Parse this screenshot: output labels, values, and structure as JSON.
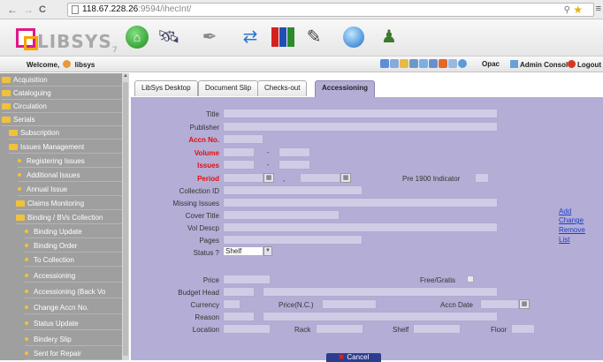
{
  "browser": {
    "url_host": "118.67.228.26",
    "url_rest": ":9594/ihecInt/",
    "back": "←",
    "forward": "→",
    "reload": "C"
  },
  "app": {
    "logo_text": "LIBSYS",
    "logo_version": "7"
  },
  "welcome": {
    "label": "Welcome,",
    "user": "libsys",
    "opac": "Opac",
    "admin_console": "Admin Console",
    "logout": "Logout"
  },
  "sidebar": {
    "items": [
      {
        "label": "Acquisition",
        "kind": "folder"
      },
      {
        "label": "Cataloguing",
        "kind": "folder"
      },
      {
        "label": "Circulation",
        "kind": "folder"
      },
      {
        "label": "Serials",
        "kind": "folder"
      },
      {
        "label": "Subscription",
        "kind": "folder"
      },
      {
        "label": "Issues Management",
        "kind": "folder"
      },
      {
        "label": "Registering Issues",
        "kind": "bullet"
      },
      {
        "label": "Additional Issues",
        "kind": "bullet"
      },
      {
        "label": "Annual Issue",
        "kind": "bullet"
      },
      {
        "label": "Claims Monitoring",
        "kind": "folder"
      },
      {
        "label": "Binding / BVs Collection",
        "kind": "folder"
      },
      {
        "label": "Binding Update",
        "kind": "bullet"
      },
      {
        "label": "Binding Order",
        "kind": "bullet"
      },
      {
        "label": "To Collection",
        "kind": "bullet"
      },
      {
        "label": "Accessioning",
        "kind": "bullet"
      },
      {
        "label": "Accessioning (Back Vo",
        "kind": "bullet"
      },
      {
        "label": "Change Accn No.",
        "kind": "bullet"
      },
      {
        "label": "Status Update",
        "kind": "bullet"
      },
      {
        "label": "Bindery Slip",
        "kind": "bullet"
      },
      {
        "label": "Sent for Repair",
        "kind": "bullet"
      }
    ]
  },
  "tabs": [
    {
      "label": "LibSys Desktop"
    },
    {
      "label": "Document Slip"
    },
    {
      "label": "Checks-out"
    },
    {
      "label": "Accessioning",
      "active": true
    }
  ],
  "form": {
    "title": "Title",
    "publisher": "Publisher",
    "accn_no": "Accn No.",
    "volume": "Volume",
    "issues": "Issues",
    "period": "Period",
    "pre1900": "Pre 1900 Indicator",
    "collection_id": "Collection ID",
    "missing_issues": "Missing Issues",
    "cover_title": "Cover Title",
    "vol_descp": "Vol Descp",
    "pages": "Pages",
    "status": "Status ?",
    "status_value": "Shelf",
    "price": "Price",
    "free_gratis": "Free/Gratis",
    "budget_head": "Budget Head",
    "currency": "Currency",
    "price_nc": "Price(N.C.)",
    "accn_date": "Accn Date",
    "reason": "Reason",
    "location": "Location",
    "rack": "Rack",
    "shelf": "Shelf",
    "floor": "Floor",
    "dash": "-",
    "comma": ","
  },
  "side_links": {
    "add": "Add",
    "change": "Change",
    "remove": "Remove",
    "list": "List"
  },
  "buttons": {
    "cancel": "Cancel"
  },
  "colors": {
    "panel": "#b4aed6",
    "sidebar": "#9f9f9f",
    "required": "#e01010",
    "link": "#1c3ec8"
  }
}
